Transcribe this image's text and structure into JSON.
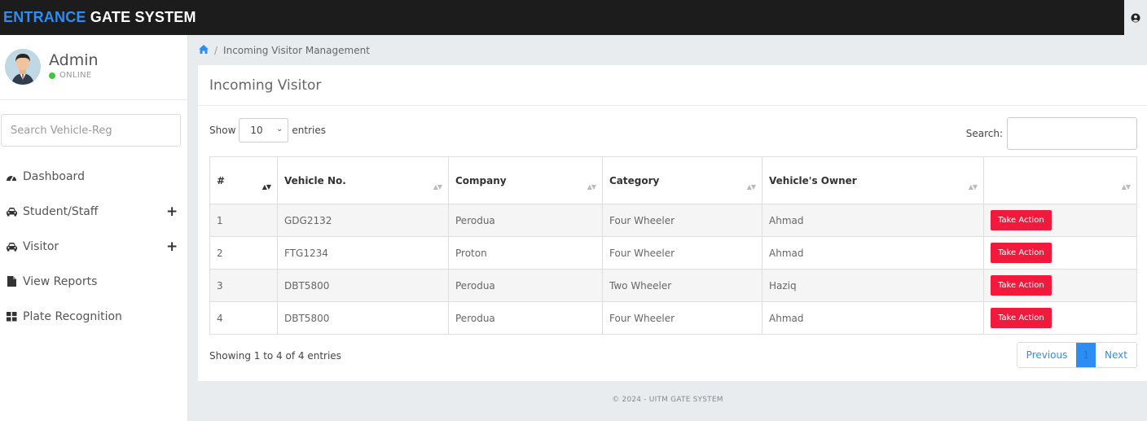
{
  "brand": {
    "part1": "ENTRANCE",
    "part2": " GATE SYSTEM"
  },
  "topbar": {
    "user_icon": "user-circle-icon"
  },
  "profile": {
    "name": "Admin",
    "status": "ONLINE"
  },
  "sidebar": {
    "search_placeholder": "Search Vehicle-Reg",
    "items": [
      {
        "label": "Dashboard",
        "icon": "dashboard-icon",
        "expand": ""
      },
      {
        "label": "Student/Staff",
        "icon": "car-icon",
        "expand": "+"
      },
      {
        "label": "Visitor",
        "icon": "car-icon",
        "expand": "+"
      },
      {
        "label": "View Reports",
        "icon": "file-icon",
        "expand": ""
      },
      {
        "label": "Plate Recognition",
        "icon": "grid-icon",
        "expand": ""
      }
    ]
  },
  "breadcrumb": {
    "current": "Incoming Visitor Management"
  },
  "card": {
    "title": "Incoming Visitor"
  },
  "table_controls": {
    "show": "Show",
    "length_value": "10",
    "entries": "entries",
    "search_label": "Search:"
  },
  "table": {
    "headers": [
      "#",
      "Vehicle No.",
      "Company",
      "Category",
      "Vehicle's Owner",
      ""
    ],
    "rows": [
      {
        "num": "1",
        "vehicle": "GDG2132",
        "company": "Perodua",
        "category": "Four Wheeler",
        "owner": "Ahmad",
        "action": "Take Action"
      },
      {
        "num": "2",
        "vehicle": "FTG1234",
        "company": "Proton",
        "category": "Four Wheeler",
        "owner": "Ahmad",
        "action": "Take Action"
      },
      {
        "num": "3",
        "vehicle": "DBT5800",
        "company": "Perodua",
        "category": "Two Wheeler",
        "owner": "Haziq",
        "action": "Take Action"
      },
      {
        "num": "4",
        "vehicle": "DBT5800",
        "company": "Perodua",
        "category": "Four Wheeler",
        "owner": "Ahmad",
        "action": "Take Action"
      }
    ]
  },
  "info": "Showing 1 to 4 of 4 entries",
  "pagination": {
    "previous": "Previous",
    "current": "1",
    "next": "Next"
  },
  "footer": "© 2024 - UITM GATE SYSTEM",
  "colors": {
    "brand_blue": "#2e8df2",
    "action_red": "#f11a3c",
    "online_green": "#3cc83c"
  }
}
